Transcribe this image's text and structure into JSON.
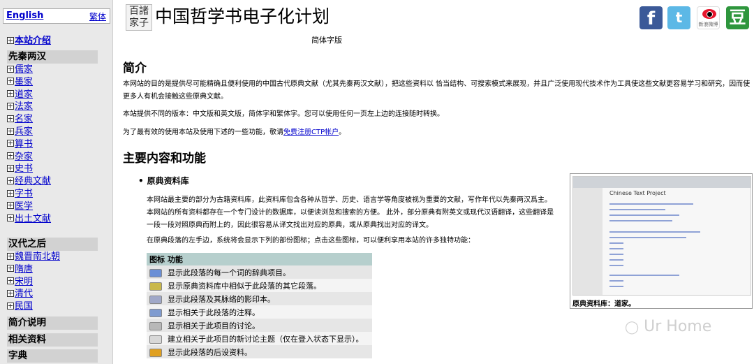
{
  "sidebar": {
    "english": "English",
    "traditional": "繁体",
    "intro": "本站介绍",
    "section_preqin": "先秦两汉",
    "preqin_items": [
      "儒家",
      "墨家",
      "道家",
      "法家",
      "名家",
      "兵家",
      "算书",
      "杂家",
      "史书",
      "经典文献",
      "字书",
      "医学",
      "出土文献"
    ],
    "section_han": "汉代之后",
    "han_items": [
      "魏晋南北朝",
      "隋唐",
      "宋明",
      "清代",
      "民国"
    ],
    "section_brief": "简介说明",
    "section_related": "相关资料",
    "section_dict": "字典"
  },
  "header": {
    "logo_text": "百諸家子",
    "title": "中国哲学书电子化计划",
    "subtitle": "简体字版",
    "social": {
      "facebook": "f",
      "twitter": "t",
      "weibo": "新浪微博",
      "douban": "豆"
    }
  },
  "main": {
    "h_intro": "简介",
    "p1": "本网站的目的是提供尽可能精确且便利使用的中国古代原典文献（尤其先秦两汉文献），把这些资料以 恰当结构、可搜索模式来展现，并且广泛使用现代技术作为工具使这些文献更容易学习和研究，因而使更多人有机会接触这些原典文献。",
    "p2": "本站提供不同的版本：中文版和英文版，简体字和繁体字。您可以使用任何一页左上边的连接随时转换。",
    "p3_pre": "为了最有效的使用本站及使用下述的一些功能，敬请",
    "p3_link": "免费注册CTP帐户",
    "p3_post": "。",
    "h_features": "主要内容和功能",
    "bullet1": "原典资料库",
    "p4": "本网站最主要的部分为古籍资料库，此资料库包含各种从哲学、历史、语言学等角度被视为重要的文献，写作年代以先秦两汉爲主。本网站的所有资料都存在一个专门设计的数据库，以便读浏览和搜索的方便。 此外，部分原典有附英文或现代汉语翻译，这些翻译是一段一段对照原典而附上的，因此很容易从译文找出对应的原典，或从原典找出对应的译文。",
    "p5": "在原典段落的左手边，系统将会显示下列的部份图标；点击这些图标，可以便利享用本站的许多独特功能：",
    "table_header": {
      "icon": "图标",
      "func": "功能"
    },
    "table_rows": [
      {
        "icon": "dict-icon",
        "text": "显示此段落的每一个词的辞典项目。",
        "color": "#6a8fd6"
      },
      {
        "icon": "parallel-icon",
        "text": "显示原典资料库中相似于此段落的其它段落。",
        "color": "#c9b84a"
      },
      {
        "icon": "scan-icon",
        "text": "显示此段落及其脉络的影印本。",
        "color": "#a0a8c8"
      },
      {
        "icon": "notes-icon",
        "text": "显示相关于此段落的注释。",
        "color": "#7f9bd0"
      },
      {
        "icon": "discussion-icon",
        "text": "显示相关于此项目的讨论。",
        "color": "#b8b8b8"
      },
      {
        "icon": "new-topic-icon",
        "text": "建立相关于此项目的新讨论主题（仅在登入状态下显示）。",
        "color": "#d8d8d8"
      },
      {
        "icon": "metadata-icon",
        "text": "显示此段落的后设资料。",
        "color": "#e0a020"
      }
    ],
    "figure_title": "Chinese Text Project",
    "figure_caption": "原典资料库：道家。"
  },
  "watermark": "Ur Home"
}
